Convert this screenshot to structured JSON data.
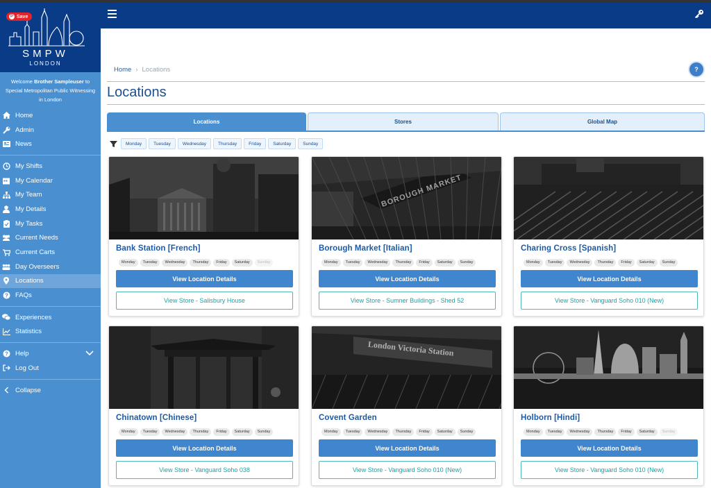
{
  "brand": {
    "save_label": "Save",
    "title": "SMPW",
    "subtitle": "LONDON"
  },
  "welcome": {
    "prefix": "Welcome ",
    "user": "Brother Sampleuser",
    "suffix": " to Special Metropolitan Public Witnessing in London"
  },
  "sidebar": {
    "groups": [
      [
        {
          "label": "Home",
          "icon": "home-icon"
        },
        {
          "label": "Admin",
          "icon": "wrench-icon"
        },
        {
          "label": "News",
          "icon": "newspaper-icon"
        }
      ],
      [
        {
          "label": "My Shifts",
          "icon": "clock-icon"
        },
        {
          "label": "My Calendar",
          "icon": "calendar-icon"
        },
        {
          "label": "My Team",
          "icon": "sitemap-icon"
        },
        {
          "label": "My Details",
          "icon": "user-icon"
        },
        {
          "label": "My Tasks",
          "icon": "clipboard-icon"
        },
        {
          "label": "Current Needs",
          "icon": "users-icon"
        },
        {
          "label": "Current Carts",
          "icon": "cart-icon"
        },
        {
          "label": "Day Overseers",
          "icon": "people-icon"
        },
        {
          "label": "Locations",
          "icon": "map-marker-icon",
          "active": true
        },
        {
          "label": "FAQs",
          "icon": "question-icon"
        }
      ],
      [
        {
          "label": "Experiences",
          "icon": "comments-icon"
        },
        {
          "label": "Statistics",
          "icon": "chart-icon"
        }
      ],
      [
        {
          "label": "Help",
          "icon": "help-icon",
          "chevron": true
        },
        {
          "label": "Log Out",
          "icon": "logout-icon"
        }
      ],
      [
        {
          "label": "Collapse",
          "icon": "chevron-left-icon"
        }
      ]
    ]
  },
  "breadcrumb": {
    "home": "Home",
    "separator": "›",
    "current": "Locations"
  },
  "help_button": "?",
  "page_title": "Locations",
  "tabs": [
    {
      "label": "Locations",
      "active": true
    },
    {
      "label": "Stores",
      "active": false
    },
    {
      "label": "Global Map",
      "active": false
    }
  ],
  "filter_days": [
    "Monday",
    "Tuesday",
    "Wednesday",
    "Thursday",
    "Friday",
    "Saturday",
    "Sunday"
  ],
  "details_label": "View Location Details",
  "cards": [
    {
      "title": "Bank Station [French]",
      "store": "View Store - Salisbury House",
      "days_off": [
        "Sunday"
      ],
      "scene": "bank"
    },
    {
      "title": "Borough Market [Italian]",
      "store": "View Store - Sumner Buildings - Shed 52",
      "days_off": [],
      "scene": "borough",
      "sign": "BOROUGH MARKET"
    },
    {
      "title": "Charing Cross [Spanish]",
      "store": "View Store - Vanguard Soho 010 (New)",
      "days_off": [],
      "scene": "charing"
    },
    {
      "title": "Chinatown [Chinese]",
      "store": "View Store - Vanguard Soho 038",
      "days_off": [],
      "scene": "chinatown"
    },
    {
      "title": "Covent Garden",
      "store": "View Store - Vanguard Soho 010 (New)",
      "days_off": [],
      "scene": "victoria",
      "sign": "London Victoria Station"
    },
    {
      "title": "Holborn [Hindi]",
      "store": "View Store - Vanguard Soho 010 (New)",
      "days_off": [
        "Sunday"
      ],
      "scene": "holborn"
    }
  ],
  "colors": {
    "header": "#0a3b87",
    "sidebar": "#4a8fd0",
    "primary_button": "#3f86cf",
    "store_button_text": "#1aa3a3"
  }
}
